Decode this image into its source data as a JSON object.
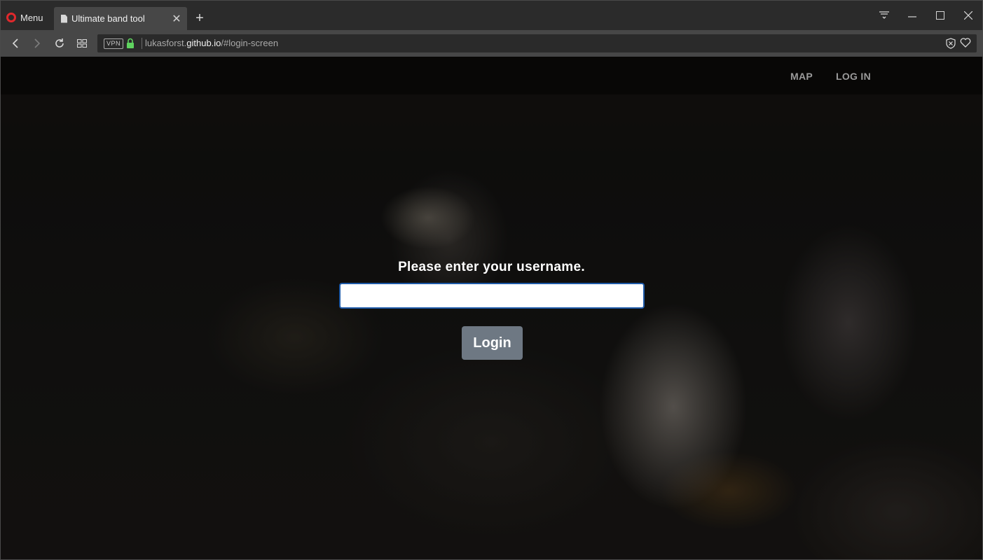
{
  "browser": {
    "menu_label": "Menu",
    "tab_title": "Ultimate band tool",
    "url_host_prefix": "lukasforst.",
    "url_host_domain": "github.io",
    "url_path": "/#login-screen",
    "vpn_label": "VPN",
    "icons": [
      "opera-logo-icon",
      "page-icon",
      "close-icon",
      "plus-icon",
      "back-icon",
      "forward-icon",
      "reload-icon",
      "speed-dial-icon",
      "lock-icon",
      "tracker-block-icon",
      "heart-icon",
      "easy-setup-icon",
      "minimize-icon",
      "maximize-icon",
      "window-close-icon"
    ]
  },
  "navbar": {
    "map_label": "MAP",
    "login_label": "LOG IN"
  },
  "login": {
    "prompt": "Please enter your username.",
    "username_value": "",
    "button_label": "Login"
  },
  "colors": {
    "accent_border": "#1e5aa8",
    "button_bg": "#6e7883",
    "lock_green": "#5fd35f"
  }
}
